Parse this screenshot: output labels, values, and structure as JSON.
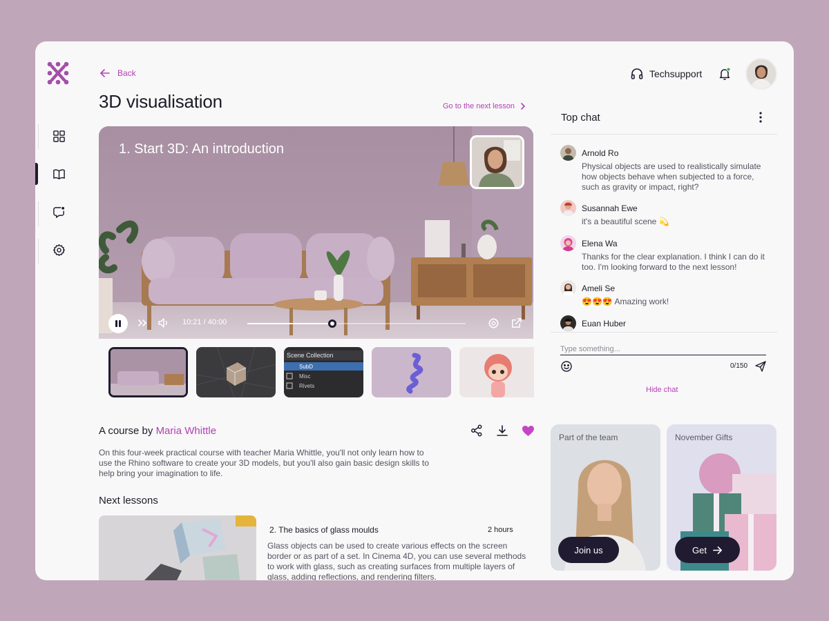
{
  "nav": {
    "back_label": "Back",
    "items": [
      "grid-icon",
      "book-icon",
      "chat-icon",
      "gear-icon"
    ]
  },
  "header": {
    "techsupport_label": "Techsupport"
  },
  "lesson": {
    "page_title": "3D visualisation",
    "next_lesson_link": "Go to the next lesson",
    "video_title": "1. Start 3D: An introduction",
    "time_label": "10:21 / 40:00",
    "progress": 0.39
  },
  "course": {
    "by_prefix": "A course by",
    "teacher": "Maria Whittle",
    "description": "On this four-week practical course with teacher Maria Whittle, you'll not only learn how to use the Rhino software to create your 3D models, but you'll also gain basic design skills to help bring your imagination to life."
  },
  "next_lessons": {
    "heading": "Next lessons",
    "items": [
      {
        "title": "2. The basics of glass moulds",
        "duration": "2 hours",
        "description": "Glass objects can be used to create various effects on the screen border or as part of a set. In Cinema 4D, you can use several methods to work with glass, such as creating surfaces from multiple layers of glass, adding reflections, and rendering filters."
      }
    ]
  },
  "chat": {
    "heading": "Top chat",
    "messages": [
      {
        "name": "Arnold Ro",
        "text": "Physical objects are used to realistically simulate how objects behave when subjected to a force, such as gravity or impact, right?"
      },
      {
        "name": "Susannah Ewe",
        "text": "it's a beautiful scene 💫"
      },
      {
        "name": "Elena Wa",
        "text": "Thanks for the clear explanation. I think I can do it too. I'm looking forward to the next lesson!"
      },
      {
        "name": "Ameli Se",
        "text": "😍😍😍  Amazing work!"
      },
      {
        "name": "Euan Huber",
        "text": ""
      }
    ],
    "input_placeholder": "Type something...",
    "char_count": "0/150",
    "hide_label": "Hide chat"
  },
  "promos": {
    "team": {
      "label": "Part of the team",
      "button": "Join us"
    },
    "gifts": {
      "label": "November Gifts",
      "button": "Get"
    }
  },
  "colors": {
    "accent": "#b33fb4",
    "dark": "#211b32",
    "background": "#c0a6b9"
  }
}
